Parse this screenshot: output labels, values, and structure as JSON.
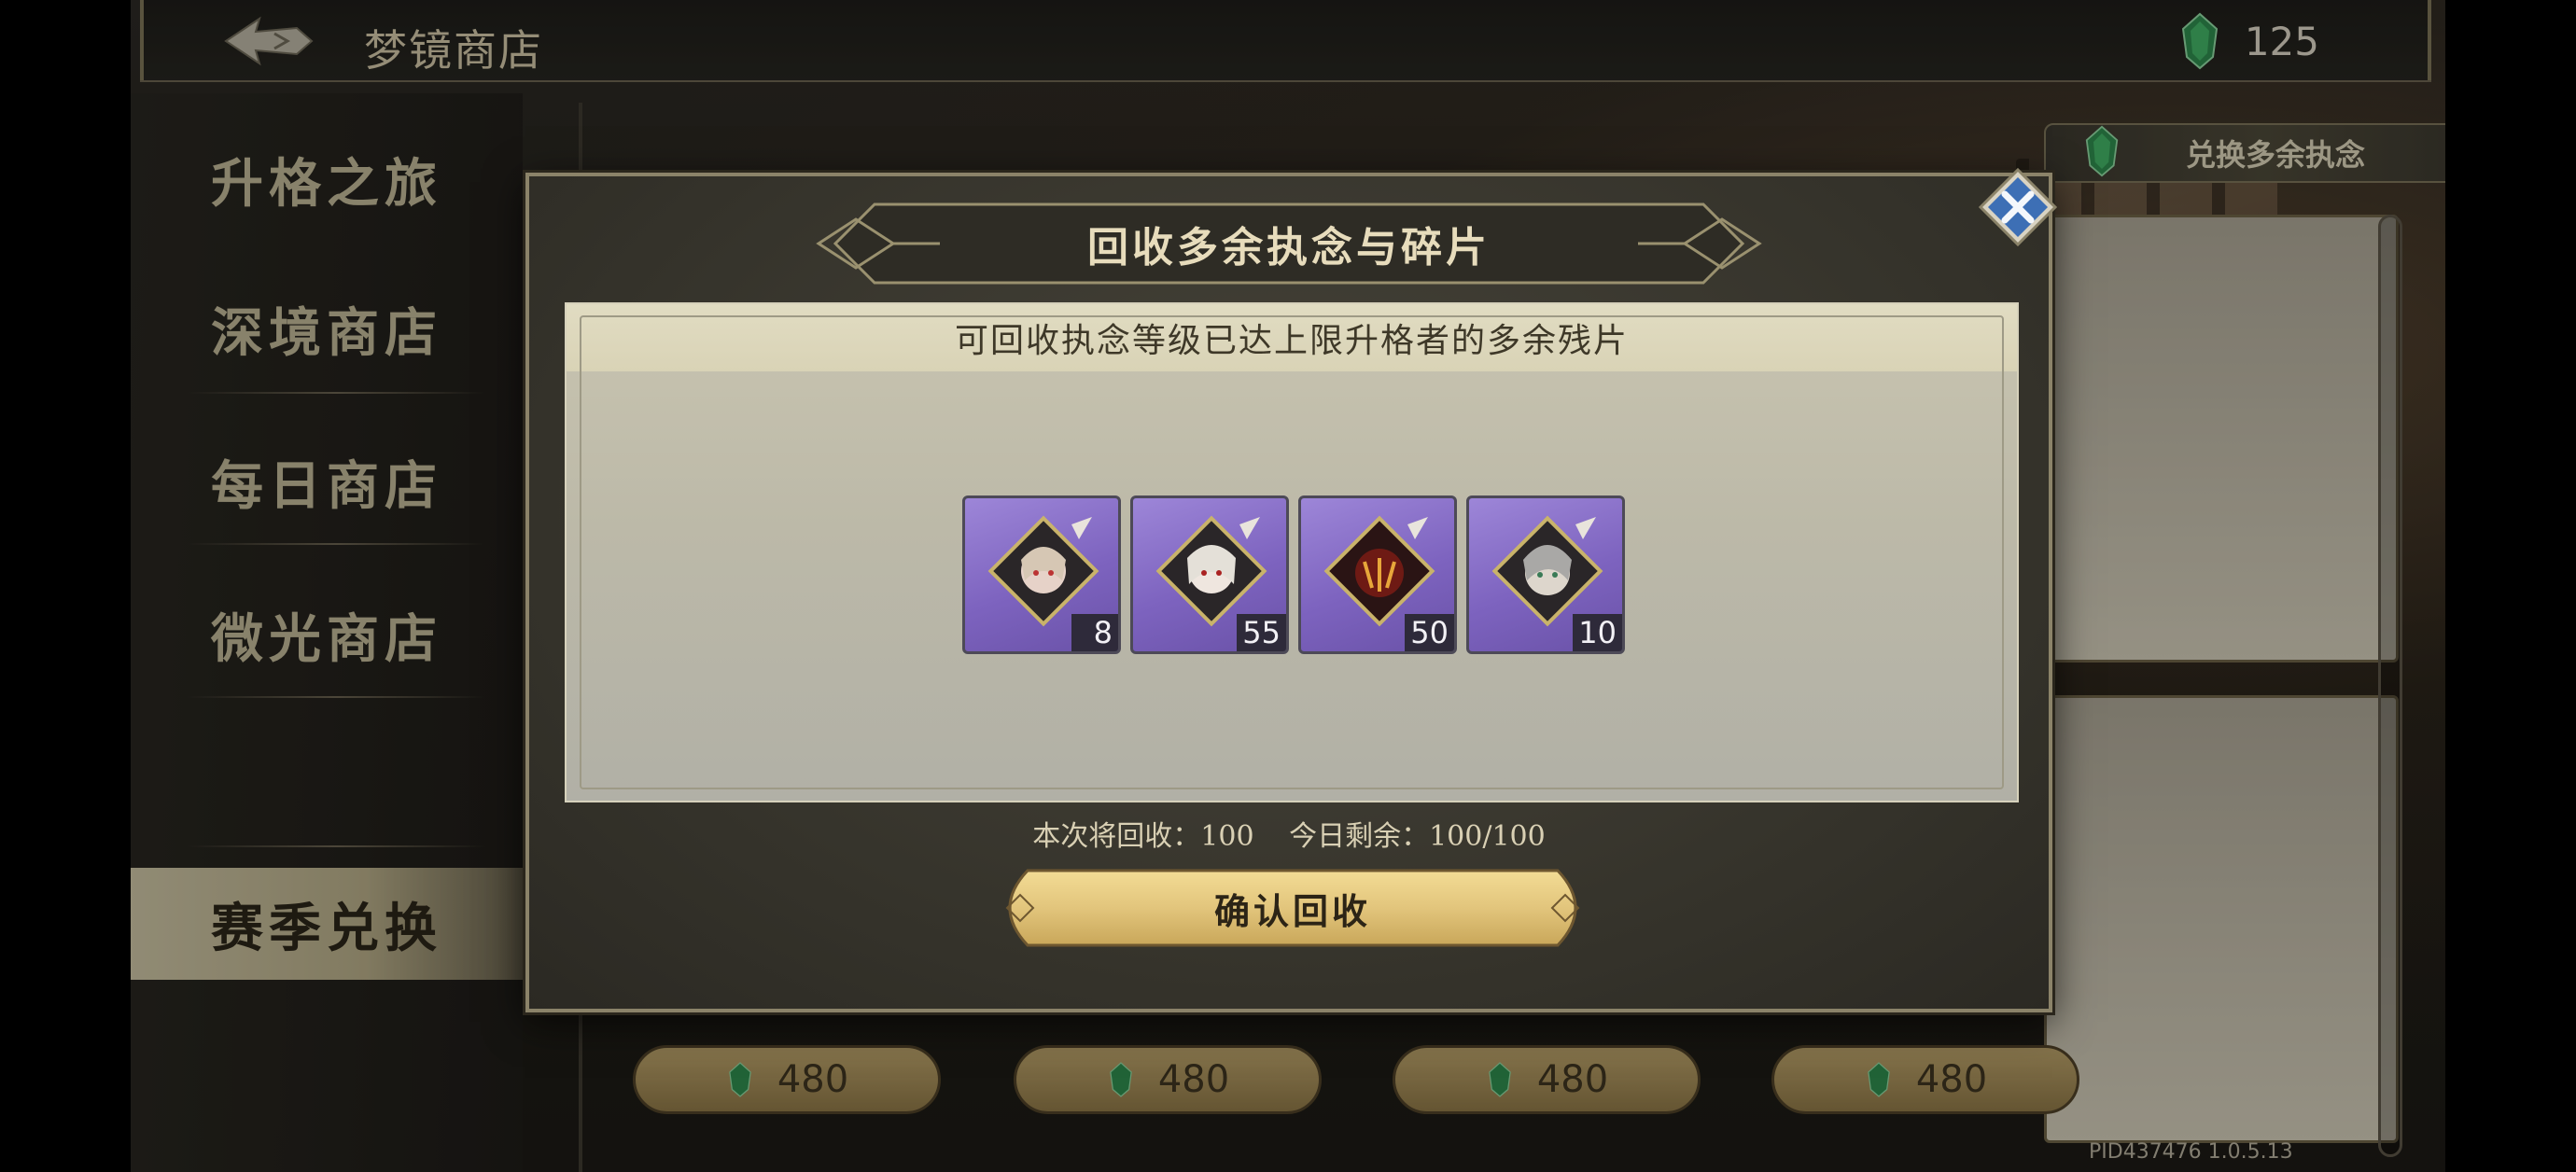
{
  "header": {
    "title": "梦镜商店",
    "currency_value": "125"
  },
  "sidebar": {
    "items": [
      {
        "label": "升格之旅",
        "active": false
      },
      {
        "label": "深境商店",
        "active": false
      },
      {
        "label": "每日商店",
        "active": false
      },
      {
        "label": "微光商店",
        "active": false
      },
      {
        "label": "赛季兑换",
        "active": true
      }
    ]
  },
  "exchange_button": {
    "label": "兑换多余执念"
  },
  "shop_prices": [
    "480",
    "480",
    "480",
    "480"
  ],
  "version": "PID437476  1.0.5.13",
  "modal": {
    "title": "回收多余执念与碎片",
    "description": "可回收执念等级已达上限升格者的多余残片",
    "items": [
      {
        "icon": "character-fragment-icon",
        "count": "8"
      },
      {
        "icon": "character-fragment-icon",
        "count": "55"
      },
      {
        "icon": "character-fragment-icon",
        "count": "50"
      },
      {
        "icon": "character-fragment-icon",
        "count": "10"
      }
    ],
    "recycle_now": "本次将回收：100",
    "remaining_today": "今日剩余：100/100",
    "confirm_label": "确认回收"
  },
  "colors": {
    "accent_gold": "#e2c57c",
    "item_rarity_purple": "#8b72cc",
    "close_blue": "#3d6fb5",
    "gem_green": "#3ea15c"
  }
}
